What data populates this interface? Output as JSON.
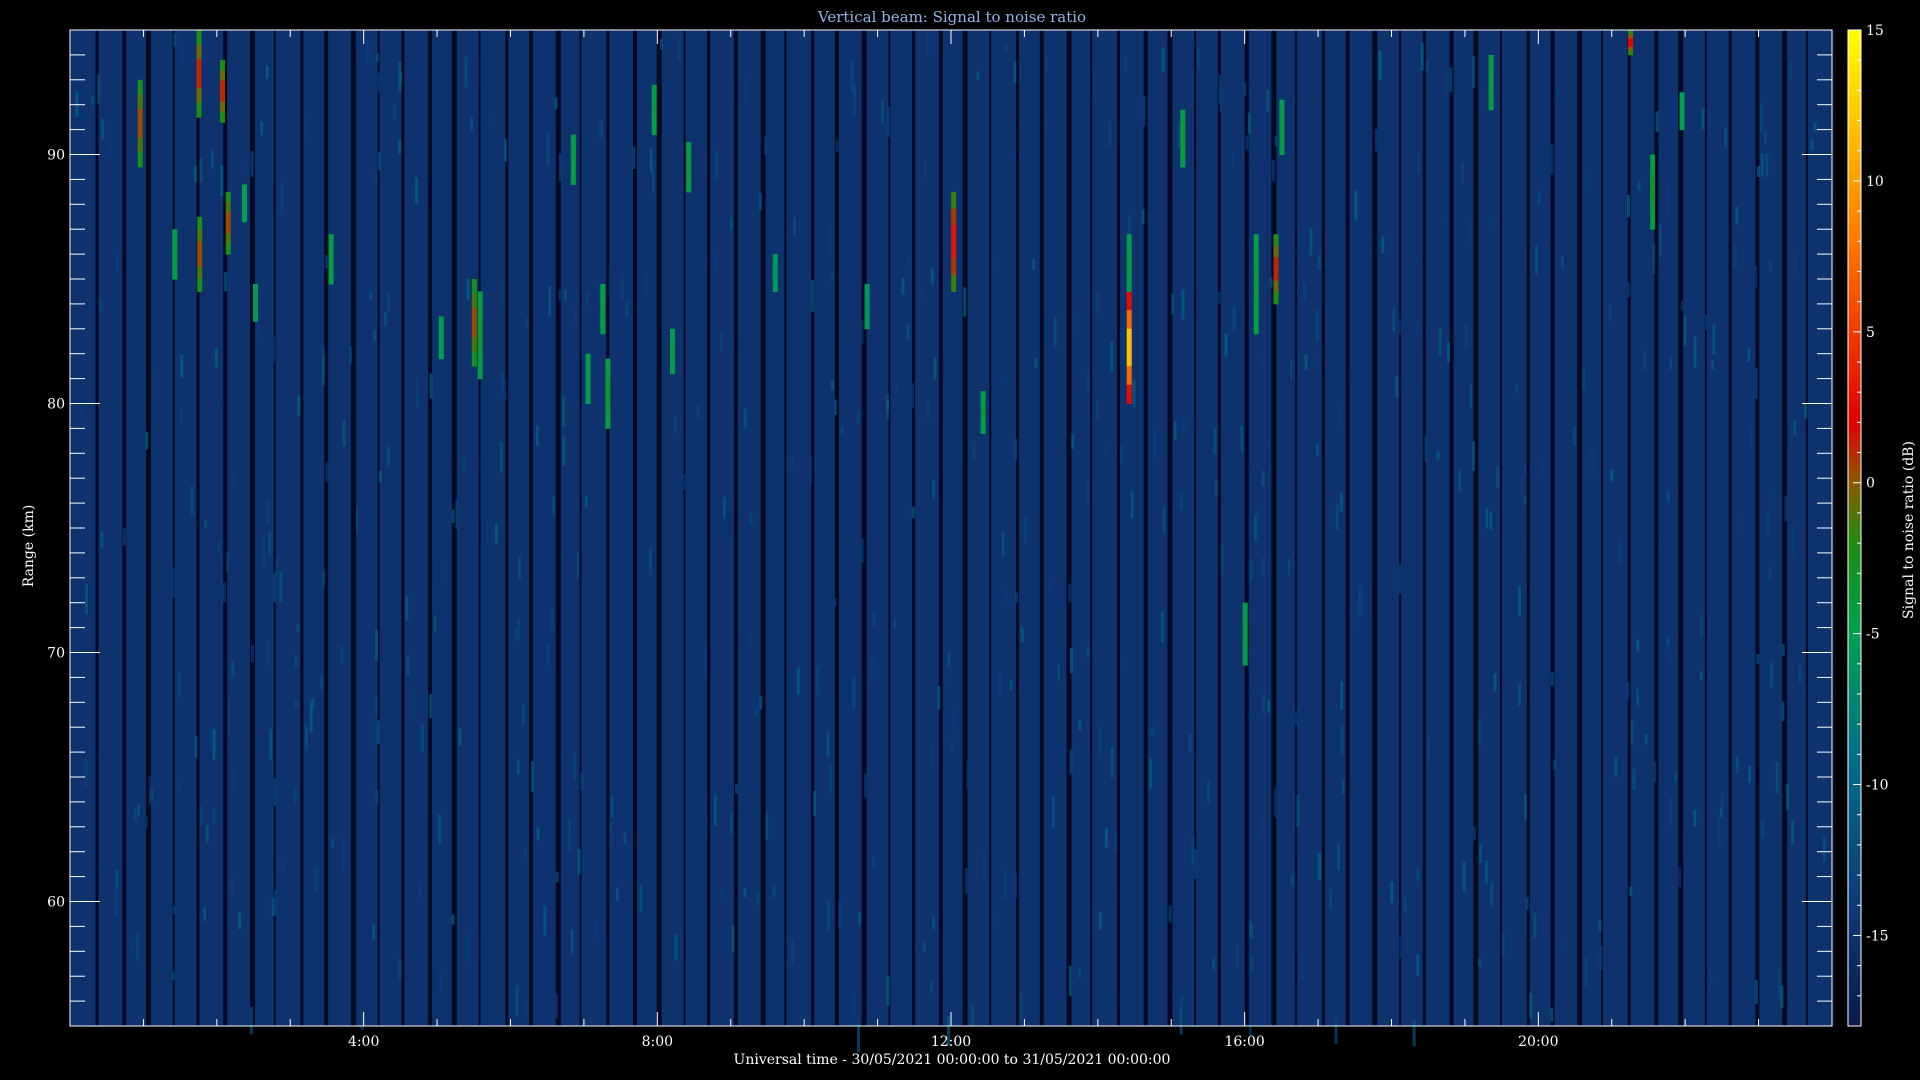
{
  "chart_data": {
    "type": "heatmap",
    "title": "Vertical beam: Signal to noise ratio",
    "xlabel": "Universal time - 30/05/2021 00:00:00 to 31/05/2021 00:00:00",
    "ylabel": "Range (km)",
    "colorbar_label": "Signal to noise ratio (dB)",
    "xlim_hours": [
      0,
      24
    ],
    "ylim_km": [
      55,
      95
    ],
    "clim_db": [
      -18,
      15
    ],
    "x_ticks": [
      {
        "value": 4,
        "label": "4:00"
      },
      {
        "value": 8,
        "label": "8:00"
      },
      {
        "value": 12,
        "label": "12:00"
      },
      {
        "value": 16,
        "label": "16:00"
      },
      {
        "value": 20,
        "label": "20:00"
      }
    ],
    "y_ticks": [
      {
        "value": 60,
        "label": "60"
      },
      {
        "value": 70,
        "label": "70"
      },
      {
        "value": 80,
        "label": "80"
      },
      {
        "value": 90,
        "label": "90"
      }
    ],
    "colorbar_ticks": [
      {
        "value": 15,
        "label": "15"
      },
      {
        "value": 10,
        "label": "10"
      },
      {
        "value": 5,
        "label": "5"
      },
      {
        "value": 0,
        "label": "0"
      },
      {
        "value": -5,
        "label": "-5"
      },
      {
        "value": -10,
        "label": "-10"
      },
      {
        "value": -15,
        "label": "-15"
      }
    ],
    "colormap": [
      {
        "value": -18,
        "color": "#0c1a4a"
      },
      {
        "value": -14,
        "color": "#0d3a78"
      },
      {
        "value": -9,
        "color": "#00708a"
      },
      {
        "value": -5,
        "color": "#00a050"
      },
      {
        "value": -2,
        "color": "#1e8c10"
      },
      {
        "value": 0,
        "color": "#8a5a00"
      },
      {
        "value": 2,
        "color": "#e00000"
      },
      {
        "value": 8,
        "color": "#ff7800"
      },
      {
        "value": 15,
        "color": "#ffff00"
      }
    ],
    "background_db": -15,
    "features": [
      {
        "t": 0.95,
        "r0": 89.5,
        "r1": 93,
        "peak": 1
      },
      {
        "t": 1.42,
        "r0": 85,
        "r1": 87,
        "peak": -4
      },
      {
        "t": 1.75,
        "r0": 91.5,
        "r1": 95,
        "peak": 2
      },
      {
        "t": 1.76,
        "r0": 84.5,
        "r1": 87.5,
        "peak": 1
      },
      {
        "t": 2.07,
        "r0": 91.3,
        "r1": 93.8,
        "peak": 2
      },
      {
        "t": 2.15,
        "r0": 86,
        "r1": 88.5,
        "peak": 1
      },
      {
        "t": 2.37,
        "r0": 87.3,
        "r1": 88.8,
        "peak": -5
      },
      {
        "t": 2.52,
        "r0": 83.3,
        "r1": 84.8,
        "peak": -6
      },
      {
        "t": 3.55,
        "r0": 84.8,
        "r1": 86.8,
        "peak": -4
      },
      {
        "t": 5.05,
        "r0": 81.8,
        "r1": 83.5,
        "peak": -5
      },
      {
        "t": 5.5,
        "r0": 81.5,
        "r1": 85,
        "peak": 1
      },
      {
        "t": 5.58,
        "r0": 81,
        "r1": 84.5,
        "peak": -3
      },
      {
        "t": 6.85,
        "r0": 88.8,
        "r1": 90.8,
        "peak": -4
      },
      {
        "t": 7.05,
        "r0": 80,
        "r1": 82,
        "peak": -5
      },
      {
        "t": 7.25,
        "r0": 82.8,
        "r1": 84.8,
        "peak": -4
      },
      {
        "t": 7.32,
        "r0": 79,
        "r1": 81.8,
        "peak": -3
      },
      {
        "t": 7.95,
        "r0": 90.8,
        "r1": 92.8,
        "peak": -4
      },
      {
        "t": 8.2,
        "r0": 81.2,
        "r1": 83,
        "peak": -4
      },
      {
        "t": 8.42,
        "r0": 88.5,
        "r1": 90.5,
        "peak": -4
      },
      {
        "t": 9.6,
        "r0": 84.5,
        "r1": 86,
        "peak": -6
      },
      {
        "t": 10.85,
        "r0": 83,
        "r1": 84.8,
        "peak": -6
      },
      {
        "t": 12.03,
        "r0": 84.5,
        "r1": 88.5,
        "peak": 4
      },
      {
        "t": 12.43,
        "r0": 78.8,
        "r1": 80.5,
        "peak": -4
      },
      {
        "t": 14.42,
        "r0": 80,
        "r1": 84.5,
        "peak": 14
      },
      {
        "t": 14.42,
        "r0": 84.5,
        "r1": 86.8,
        "peak": -4
      },
      {
        "t": 15.15,
        "r0": 89.5,
        "r1": 91.8,
        "peak": -4
      },
      {
        "t": 16.0,
        "r0": 69.5,
        "r1": 72,
        "peak": -4
      },
      {
        "t": 16.15,
        "r0": 82.8,
        "r1": 86.8,
        "peak": -4
      },
      {
        "t": 16.42,
        "r0": 84,
        "r1": 86.8,
        "peak": 2
      },
      {
        "t": 16.5,
        "r0": 90,
        "r1": 92.2,
        "peak": -4
      },
      {
        "t": 19.35,
        "r0": 91.8,
        "r1": 94,
        "peak": -4
      },
      {
        "t": 21.25,
        "r0": 94,
        "r1": 95,
        "peak": 3
      },
      {
        "t": 21.55,
        "r0": 87,
        "r1": 90,
        "peak": -3
      },
      {
        "t": 21.95,
        "r0": 91,
        "r1": 92.5,
        "peak": -5
      }
    ]
  }
}
